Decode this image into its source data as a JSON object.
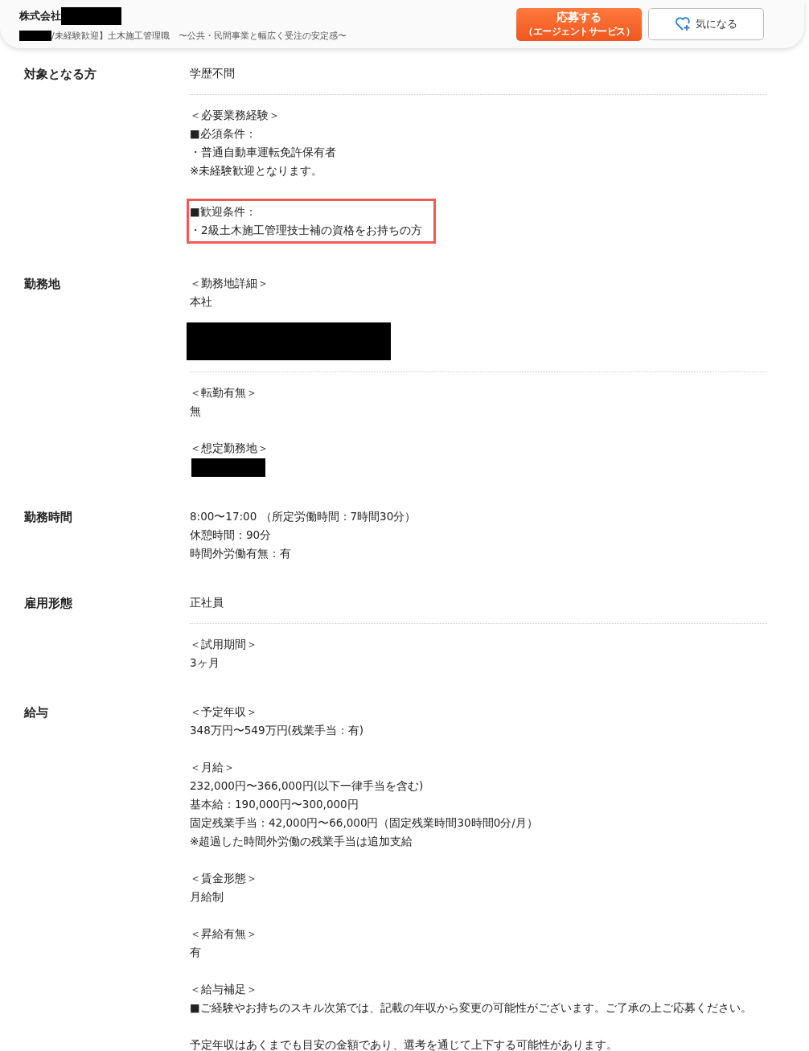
{
  "header": {
    "company": "株式会社",
    "job_title": "/未経験歓迎】土木施工管理職　〜公共・民間事業と幅広く受注の安定感〜",
    "apply_button": {
      "label": "応募する",
      "sublabel": "（エージェントサービス）"
    },
    "favorite_button": {
      "label": "気になる"
    }
  },
  "sections": [
    {
      "label": "対象となる方",
      "groups": [
        [
          {
            "kind": "text",
            "highlighted": false,
            "lines": [
              "学歴不問"
            ]
          }
        ],
        [
          {
            "kind": "text",
            "highlighted": false,
            "lines": [
              "＜必要業務経験＞",
              "■必須条件：",
              "・普通自動車運転免許保有者",
              "※未経験歓迎となります。"
            ]
          },
          {
            "kind": "text",
            "highlighted": true,
            "lines": [
              "■歓迎条件：",
              "・2級土木施工管理技士補の資格をお持ちの方"
            ]
          }
        ]
      ]
    },
    {
      "label": "勤務地",
      "groups": [
        [
          {
            "kind": "text",
            "highlighted": false,
            "lines": [
              "＜勤務地詳細＞",
              "本社"
            ]
          },
          {
            "kind": "redacted-wide"
          }
        ],
        [
          {
            "kind": "text",
            "highlighted": false,
            "lines": [
              "＜転勤有無＞",
              "無"
            ]
          },
          {
            "kind": "text",
            "highlighted": false,
            "lines": [
              "＜想定勤務地＞"
            ]
          },
          {
            "kind": "redacted-narrow"
          }
        ]
      ]
    },
    {
      "label": "勤務時間",
      "groups": [
        [
          {
            "kind": "text",
            "highlighted": false,
            "lines": [
              "8:00〜17:00 （所定労働時間：7時間30分）",
              "休憩時間：90分",
              "時間外労働有無：有"
            ]
          }
        ]
      ]
    },
    {
      "label": "雇用形態",
      "groups": [
        [
          {
            "kind": "text",
            "highlighted": false,
            "lines": [
              "正社員"
            ]
          }
        ],
        [
          {
            "kind": "text",
            "highlighted": false,
            "lines": [
              "＜試用期間＞",
              "3ヶ月"
            ]
          }
        ]
      ]
    },
    {
      "label": "給与",
      "groups": [
        [
          {
            "kind": "text",
            "highlighted": false,
            "lines": [
              "＜予定年収＞",
              "348万円〜549万円(残業手当：有)"
            ]
          },
          {
            "kind": "text",
            "highlighted": false,
            "lines": [
              "＜月給＞",
              "232,000円〜366,000円(以下一律手当を含む)",
              "基本給：190,000円〜300,000円",
              "固定残業手当：42,000円〜66,000円（固定残業時間30時間0分/月）",
              "※超過した時間外労働の残業手当は追加支給"
            ]
          },
          {
            "kind": "text",
            "highlighted": false,
            "lines": [
              "＜賃金形態＞",
              "月給制"
            ]
          },
          {
            "kind": "text",
            "highlighted": false,
            "lines": [
              "＜昇給有無＞",
              "有"
            ]
          },
          {
            "kind": "text",
            "highlighted": false,
            "lines": [
              "＜給与補足＞",
              "■ご経験やお持ちのスキル次第では、記載の年収から変更の可能性がございます。ご了承の上ご応募ください。"
            ]
          },
          {
            "kind": "text",
            "highlighted": false,
            "lines": [
              "予定年収はあくまでも目安の金額であり、選考を通じて上下する可能性があります。"
            ]
          }
        ]
      ]
    }
  ]
}
